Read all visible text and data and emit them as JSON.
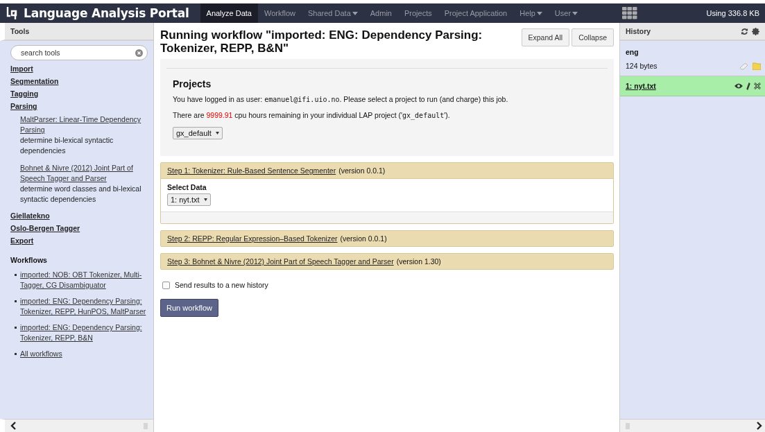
{
  "navbar": {
    "brand": "Language Analysis Portal",
    "items": [
      {
        "label": "Analyze Data",
        "selected": true,
        "dropdown": false
      },
      {
        "label": "Workflow",
        "selected": false,
        "dropdown": false
      },
      {
        "label": "Shared Data",
        "selected": false,
        "dropdown": true
      },
      {
        "label": "Admin",
        "selected": false,
        "dropdown": false
      },
      {
        "label": "Projects",
        "selected": false,
        "dropdown": false
      },
      {
        "label": "Project Application",
        "selected": false,
        "dropdown": false
      },
      {
        "label": "Help",
        "selected": false,
        "dropdown": true
      },
      {
        "label": "User",
        "selected": false,
        "dropdown": true
      }
    ],
    "usage": "Using 336.8 KB"
  },
  "tools": {
    "title": "Tools",
    "search": {
      "placeholder": "search tools"
    },
    "sections": [
      {
        "label": "Import"
      },
      {
        "label": "Segmentation"
      },
      {
        "label": "Tagging"
      },
      {
        "label": "Parsing",
        "children": [
          {
            "link": "MaltParser: Linear-Time Dependency Parsing",
            "description": "determine bi-lexical syntactic dependencies"
          },
          {
            "link": "Bohnet & Nivre (2012) Joint Part of Speech Tagger and Parser",
            "description": "determine word classes and bi-lexical syntactic dependencies"
          }
        ]
      },
      {
        "label": "Giellatekno"
      },
      {
        "label": "Oslo-Bergen Tagger"
      },
      {
        "label": "Export"
      }
    ],
    "workflows_title": "Workflows",
    "workflows": [
      "imported: NOB: OBT Tokenizer, Multi-Tagger, CG Disambiguator",
      "imported: ENG: Dependency Parsing: Tokenizer, REPP, HunPOS, MaltParser",
      "imported: ENG: Dependency Parsing: Tokenizer, REPP, B&N",
      "All workflows"
    ]
  },
  "main": {
    "title": "Running workflow \"imported: ENG: Dependency Parsing: Tokenizer, REPP, B&N\"",
    "buttons": [
      "Expand All",
      "Collapse"
    ],
    "projects": {
      "heading": "Projects",
      "lines": [
        [
          {
            "kind": "text",
            "text": "You have logged in as user: "
          },
          {
            "kind": "code",
            "text": "emanuel@ifi.uio.no"
          },
          {
            "kind": "text",
            "text": ". Please select a project to run (and charge) this job."
          }
        ],
        [
          {
            "kind": "text",
            "text": "There are "
          },
          {
            "kind": "alert",
            "text": "9999.91"
          },
          {
            "kind": "text",
            "text": " cpu hours remaining in your individual LAP project ('"
          },
          {
            "kind": "code",
            "text": "gx_default"
          },
          {
            "kind": "text",
            "text": "')."
          }
        ]
      ],
      "select": "gx_default"
    },
    "steps": [
      {
        "link": "Step 1: Tokenizer: Rule-Based Sentence Segmenter",
        "version": "(version 0.0.1)",
        "expanded": true,
        "field_label": "Select Data",
        "field_value": "1: nyt.txt"
      },
      {
        "link": "Step 2: REPP: Regular Expression–Based Tokenizer",
        "version": "(version 0.0.1)",
        "expanded": false
      },
      {
        "link": "Step 3: Bohnet & Nivre (2012) Joint Part of Speech Tagger and Parser",
        "version": "(version 1.30)",
        "expanded": false
      }
    ],
    "new_history": {
      "label": "Send results to a new history",
      "checked": false
    },
    "run_button": "Run workflow"
  },
  "history": {
    "title": "History",
    "name": "eng",
    "size": "124 bytes",
    "datasets": [
      {
        "label": "1: nyt.txt"
      }
    ]
  }
}
